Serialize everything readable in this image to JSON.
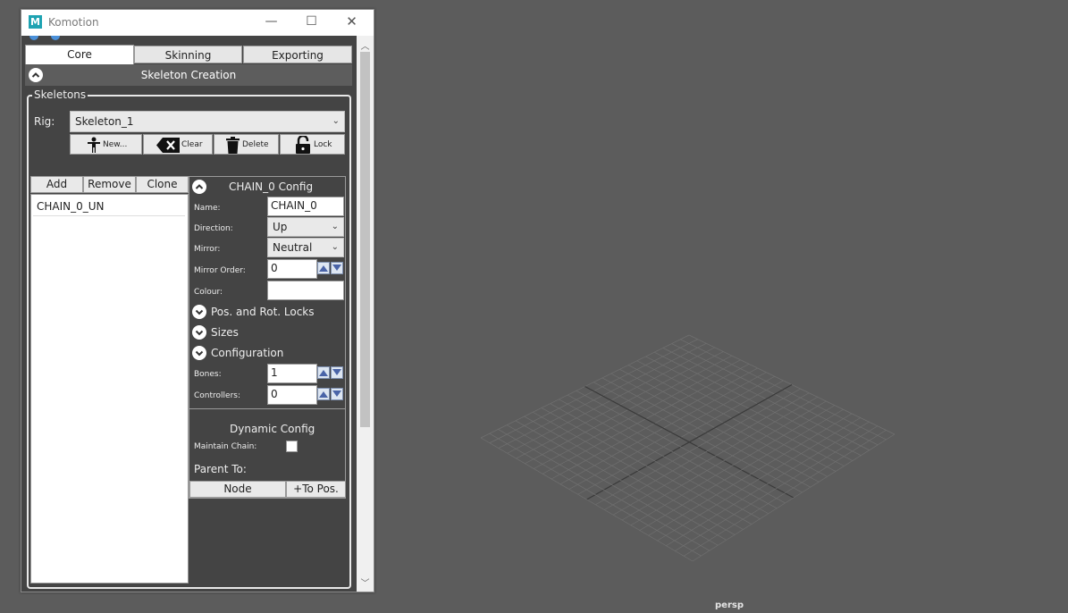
{
  "window": {
    "title": "Komotion",
    "icon_letter": "M",
    "minimize_glyph": "—",
    "maximize_glyph": "☐",
    "close_glyph": "✕"
  },
  "tabs": [
    {
      "label": "Core",
      "active": true
    },
    {
      "label": "Skinning",
      "active": false
    },
    {
      "label": "Exporting",
      "active": false
    }
  ],
  "section": {
    "title": "Skeleton Creation",
    "collapse_icon": "chevron-up-icon"
  },
  "skeletons": {
    "legend": "Skeletons",
    "rig_label": "Rig:",
    "rig_value": "Skeleton_1",
    "toolbar": [
      {
        "label": "New...",
        "icon": "person-icon"
      },
      {
        "label": "Clear",
        "icon": "backspace-x-icon"
      },
      {
        "label": "Delete",
        "icon": "trash-icon"
      },
      {
        "label": "Lock",
        "icon": "unlock-icon"
      }
    ]
  },
  "chains": {
    "buttons": [
      "Add",
      "Remove",
      "Clone"
    ],
    "items": [
      "CHAIN_0_UN"
    ]
  },
  "config": {
    "title": "CHAIN_0 Config",
    "name_label": "Name:",
    "name_value": "CHAIN_0",
    "direction_label": "Direction:",
    "direction_value": "Up",
    "mirror_label": "Mirror:",
    "mirror_value": "Neutral",
    "mirror_order_label": "Mirror Order:",
    "mirror_order_value": "0",
    "colour_label": "Colour:",
    "colour_value": "",
    "expanders": [
      "Pos. and Rot. Locks",
      "Sizes",
      "Configuration"
    ],
    "bones_label": "Bones:",
    "bones_value": "1",
    "controllers_label": "Controllers:",
    "controllers_value": "0",
    "dynamic_title": "Dynamic Config",
    "maintain_label": "Maintain Chain:",
    "maintain_checked": false,
    "parent_label": "Parent To:",
    "node_button": "Node",
    "to_pos_button": "+To Pos."
  },
  "viewport": {
    "camera_label": "persp"
  },
  "colors": {
    "viewport_bg": "#5c5c5c",
    "panel_bg": "#444444",
    "header_bg": "#5d5d5d",
    "spin_arrow": "#4a64a8"
  }
}
